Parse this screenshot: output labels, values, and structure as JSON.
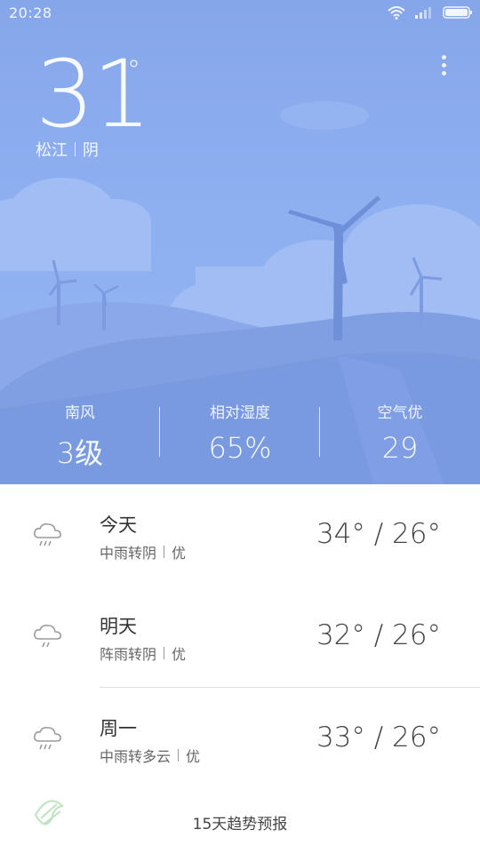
{
  "status_bar": {
    "time": "20:28"
  },
  "current": {
    "temperature": "31",
    "degree_symbol": "°",
    "location": "松江",
    "condition": "阴"
  },
  "stats": [
    {
      "label": "南风",
      "value": "3级"
    },
    {
      "label": "相对湿度",
      "value": "65%"
    },
    {
      "label": "空气优",
      "value": "29"
    }
  ],
  "forecast": [
    {
      "day": "今天",
      "condition": "中雨转阴",
      "air": "优",
      "temps": "34° / 26°",
      "icon": "rain-cloud-icon"
    },
    {
      "day": "明天",
      "condition": "阵雨转阴",
      "air": "优",
      "temps": "32° / 26°",
      "icon": "shower-cloud-icon"
    },
    {
      "day": "周一",
      "condition": "中雨转多云",
      "air": "优",
      "temps": "33° / 26°",
      "icon": "rain-cloud-icon"
    }
  ],
  "trend_link": "15天趋势预报",
  "colors": {
    "sky": "#8eb0f1",
    "hill": "#7d9de2",
    "turbine": "#6f8fd8",
    "text_dark": "#333333"
  }
}
